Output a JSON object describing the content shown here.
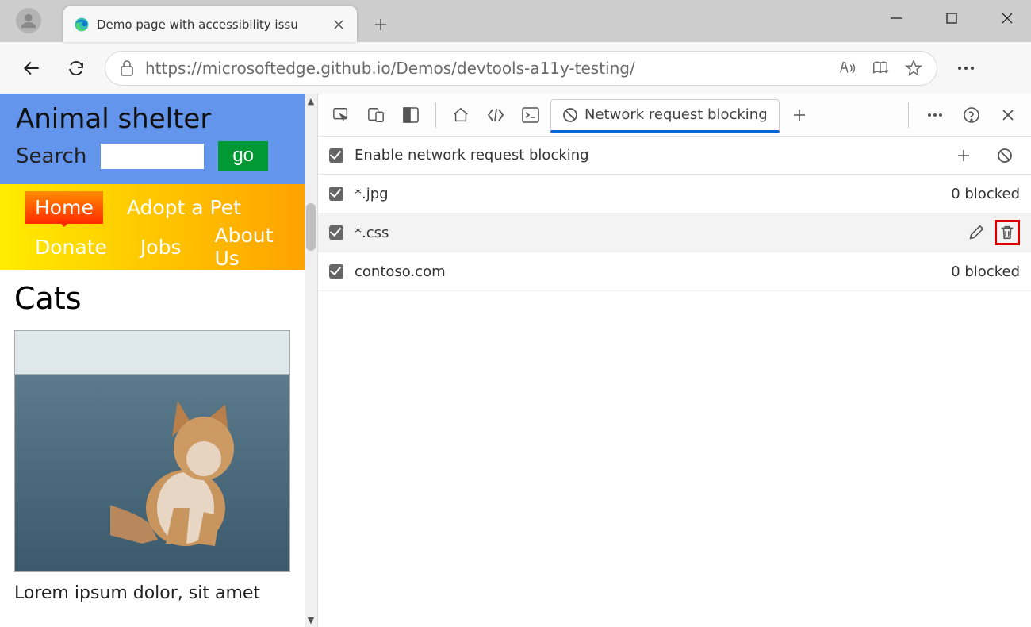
{
  "browser": {
    "tab_title": "Demo page with accessibility issu",
    "url": "https://microsoftedge.github.io/Demos/devtools-a11y-testing/"
  },
  "site": {
    "title": "Animal shelter",
    "search_label": "Search",
    "go_label": "go",
    "nav": {
      "home": "Home",
      "adopt": "Adopt a Pet",
      "donate": "Donate",
      "jobs": "Jobs",
      "about": "About Us"
    },
    "heading": "Cats",
    "paragraph": "Lorem ipsum dolor, sit amet"
  },
  "devtools": {
    "tab_label": "Network request blocking",
    "enable_label": "Enable network request blocking",
    "rows": [
      {
        "pattern": "*.jpg",
        "count_text": "0 blocked",
        "hover": false
      },
      {
        "pattern": "*.css",
        "count_text": "",
        "hover": true
      },
      {
        "pattern": "contoso.com",
        "count_text": "0 blocked",
        "hover": false
      }
    ]
  }
}
